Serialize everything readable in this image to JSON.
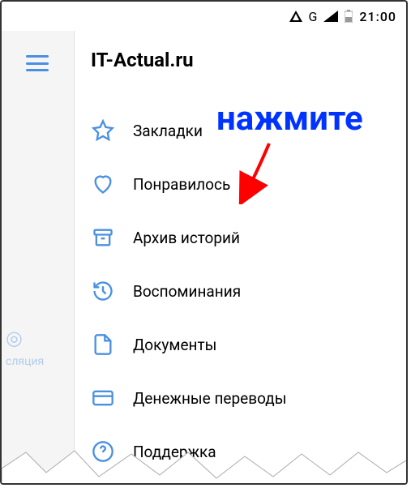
{
  "status_bar": {
    "network_letter": "G",
    "time": "21:00"
  },
  "left_panel": {
    "faded_label": "сляция"
  },
  "main": {
    "title": "IT-Actual.ru",
    "menu": [
      {
        "label": "Закладки"
      },
      {
        "label": "Понравилось"
      },
      {
        "label": "Архив историй"
      },
      {
        "label": "Воспоминания"
      },
      {
        "label": "Документы"
      },
      {
        "label": "Денежные переводы"
      },
      {
        "label": "Поддержка"
      }
    ]
  },
  "annotation": {
    "text": "нажмите"
  }
}
